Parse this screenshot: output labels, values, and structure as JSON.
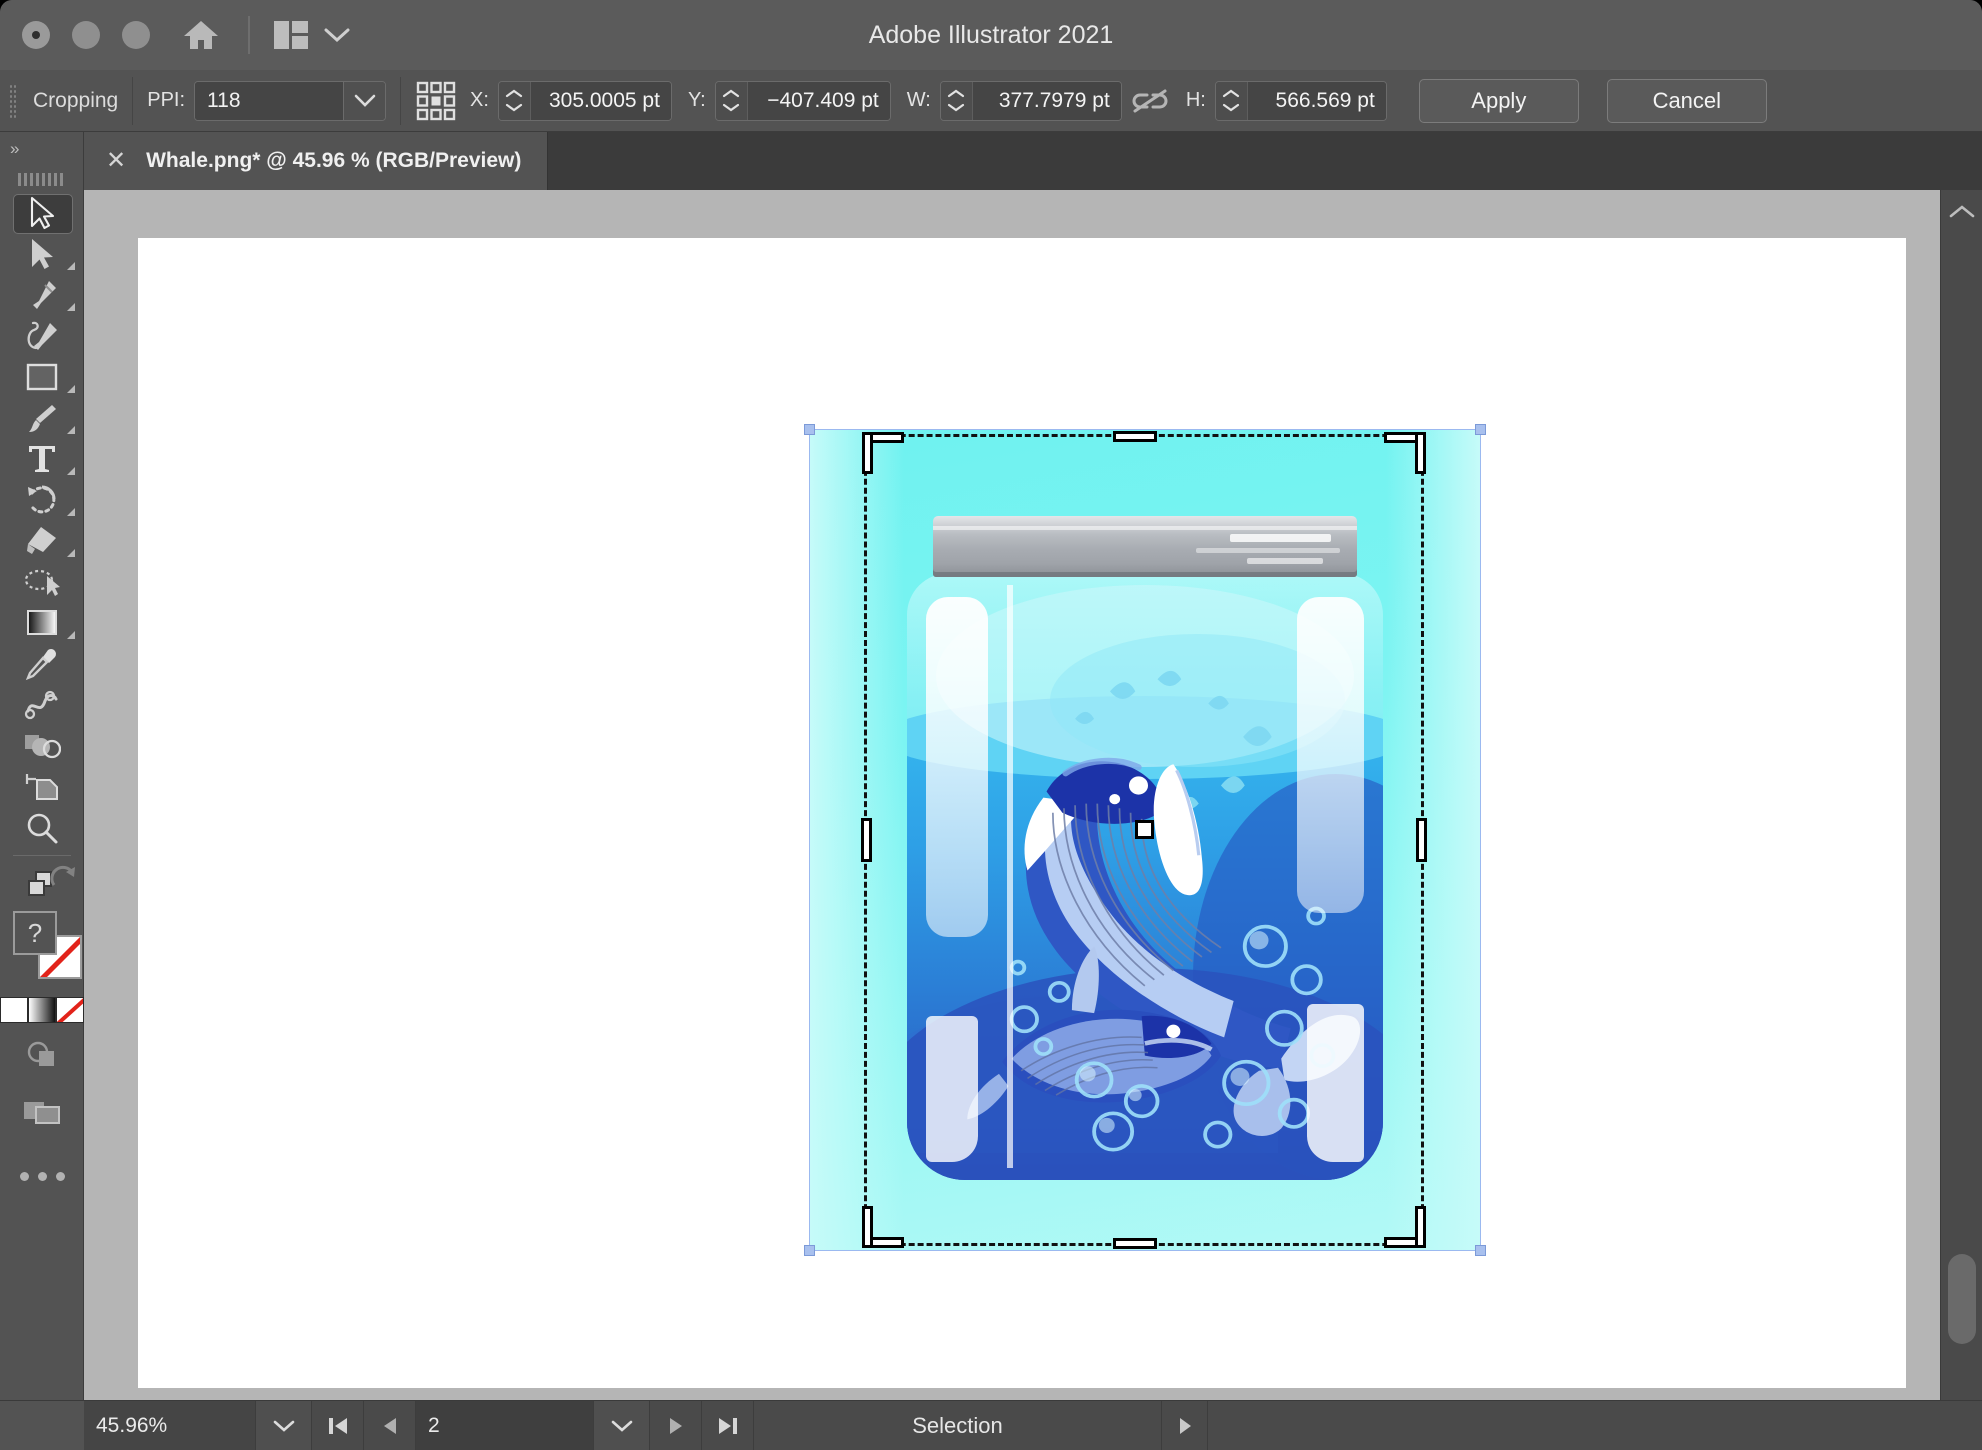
{
  "window": {
    "title": "Adobe Illustrator 2021",
    "traffic_lights": [
      "close",
      "minimize",
      "maximize"
    ],
    "home_icon": "home-icon",
    "arrange_icon": "arrange-documents-icon",
    "arrange_chevron": "chevron-down-icon"
  },
  "control_bar": {
    "mode_label": "Cropping",
    "ppi_label": "PPI:",
    "ppi_value": "118",
    "reference_point_icon": "reference-point-matrix-icon",
    "x_label": "X:",
    "x_value": "305.0005 pt",
    "y_label": "Y:",
    "y_value": "−407.409 pt",
    "w_label": "W:",
    "w_value": "377.7979 pt",
    "link_icon": "broken-chain-link-icon",
    "h_label": "H:",
    "h_value": "566.569 pt",
    "apply_label": "Apply",
    "cancel_label": "Cancel"
  },
  "tab": {
    "close_icon": "close-icon",
    "title": "Whale.png* @ 45.96 % (RGB/Preview)"
  },
  "toolbar": {
    "collapse_label": "»",
    "grip": "panel-grip",
    "tools": [
      {
        "name": "selection-tool",
        "active": true,
        "has_flyout": false
      },
      {
        "name": "direct-selection-tool",
        "active": false,
        "has_flyout": true
      },
      {
        "name": "pen-tool",
        "active": false,
        "has_flyout": true
      },
      {
        "name": "curvature-tool",
        "active": false,
        "has_flyout": false
      },
      {
        "name": "rectangle-tool",
        "active": false,
        "has_flyout": true
      },
      {
        "name": "paintbrush-tool",
        "active": false,
        "has_flyout": true
      },
      {
        "name": "type-tool",
        "active": false,
        "has_flyout": true
      },
      {
        "name": "rotate-tool",
        "active": false,
        "has_flyout": true
      },
      {
        "name": "eraser-tool",
        "active": false,
        "has_flyout": true
      },
      {
        "name": "scale-tool",
        "active": false,
        "has_flyout": false
      },
      {
        "name": "gradient-tool",
        "active": false,
        "has_flyout": true
      },
      {
        "name": "eyedropper-tool",
        "active": false,
        "has_flyout": false
      },
      {
        "name": "blend-tool",
        "active": false,
        "has_flyout": false
      },
      {
        "name": "shape-builder-tool",
        "active": false,
        "has_flyout": false
      },
      {
        "name": "artboard-tool",
        "active": false,
        "has_flyout": false
      },
      {
        "name": "zoom-tool",
        "active": false,
        "has_flyout": false
      }
    ],
    "swap_fill_stroke_icon": "swap-fill-stroke-icon",
    "revert_default_icon": "default-fill-stroke-icon",
    "fill_swatch_label": "?",
    "stroke_swatch": "none-stroke-red-slash",
    "mini_swatches": [
      "color-swatch",
      "gradient-swatch",
      "none-swatch"
    ],
    "drawing_mode_icon": "draw-normal-icon",
    "screen_mode_icon": "screen-mode-icon",
    "more_tools_icon": "edit-toolbar-ellipsis-icon"
  },
  "canvas": {
    "artwork_name": "whale-in-jar-illustration",
    "selection": {
      "center_handle": "selection-center-point",
      "crop_overlay": "crop-marquee"
    }
  },
  "scrollbars": {
    "vertical_up_icon": "chevron-up-icon",
    "horizontal_left_icon": "chevron-left-icon"
  },
  "status_bar": {
    "zoom_value": "45.96%",
    "zoom_dropdown_icon": "chevron-down-icon",
    "first_artboard_icon": "first-artboard-icon",
    "prev_artboard_icon": "previous-artboard-icon",
    "artboard_number": "2",
    "artboard_dropdown_icon": "chevron-down-icon",
    "next_artboard_icon": "next-artboard-icon",
    "last_artboard_icon": "last-artboard-icon",
    "status_text": "Selection",
    "status_menu_icon": "play-triangle-icon"
  }
}
